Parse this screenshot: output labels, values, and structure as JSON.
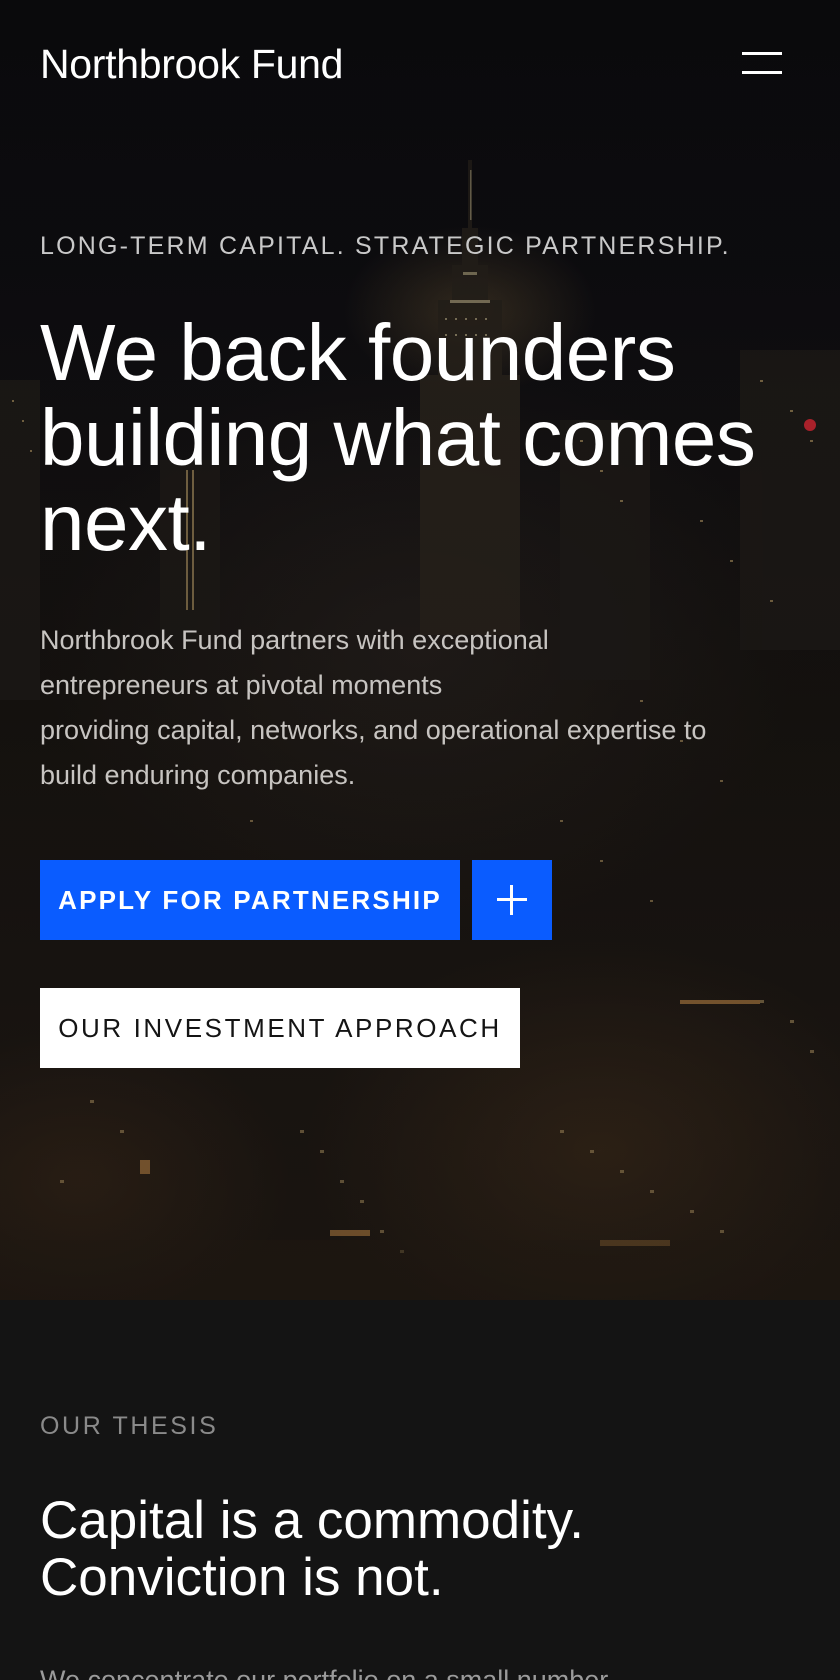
{
  "header": {
    "brand": "Northbrook Fund",
    "menu_icon": "hamburger-menu-icon"
  },
  "hero": {
    "eyebrow": "LONG-TERM CAPITAL. STRATEGIC PARTNERSHIP.",
    "headline": "We back founders building what comes next.",
    "lede_lines": [
      "Northbrook Fund partners with exceptional",
      "entrepreneurs at pivotal moments",
      "providing capital, networks, and operational expertise to",
      "build enduring companies."
    ],
    "primary_cta": "APPLY FOR PARTNERSHIP",
    "plus_icon": "plus-icon",
    "secondary_cta": "OUR INVESTMENT APPROACH"
  },
  "thesis": {
    "eyebrow": "OUR THESIS",
    "title_lines": [
      "Capital is a commodity.",
      "Conviction is not."
    ],
    "body_partial": "We concentrate our portfolio on a small number"
  },
  "colors": {
    "accent": "#0a5cff",
    "page_background": "#141414",
    "secondary_button_bg": "#ffffff"
  }
}
